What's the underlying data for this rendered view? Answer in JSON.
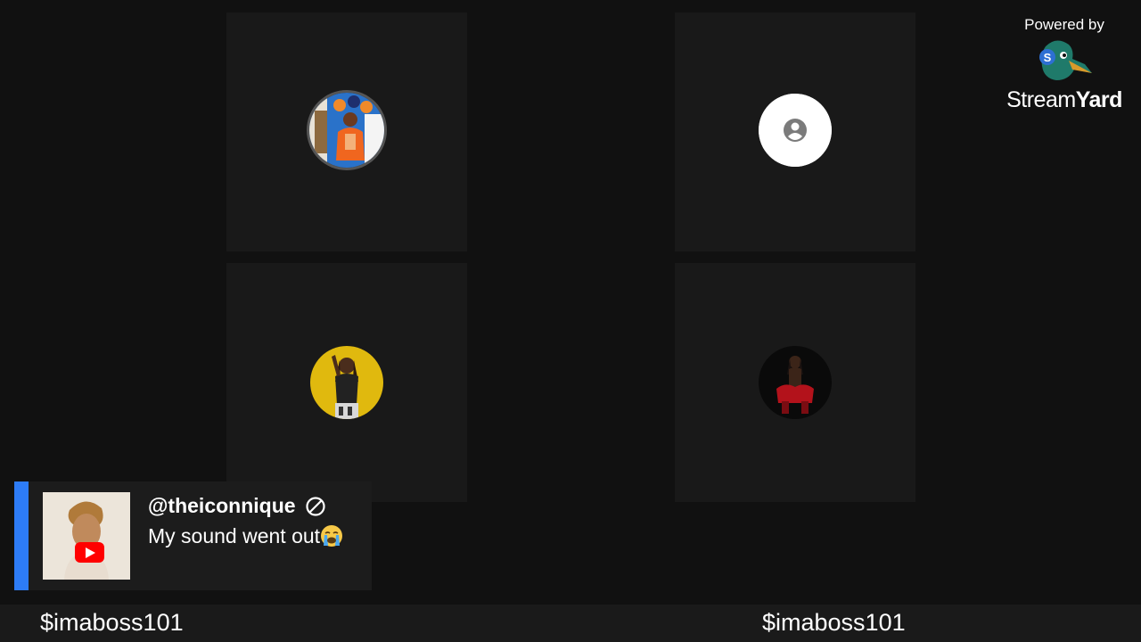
{
  "branding": {
    "powered_by": "Powered by",
    "wordmark_light": "Stream",
    "wordmark_bold": "Yard",
    "logo_icon": "streamyard-duck-icon",
    "logo_badge": "S"
  },
  "participants": [
    {
      "avatar_icon": "participant-photo-orange-outfit"
    },
    {
      "avatar_icon": "default-user-icon"
    },
    {
      "avatar_icon": "participant-photo-yellow-background"
    },
    {
      "avatar_icon": "participant-photo-red-outfit"
    }
  ],
  "comment": {
    "handle": "@theiconnique",
    "text": "My sound went out",
    "emoji_icon": "crying-face-icon",
    "platform_icon": "youtube-icon",
    "accent_color": "#2d7cf6"
  },
  "bottom_bar": {
    "left_label": "$imaboss101",
    "right_label": "$imaboss101"
  }
}
